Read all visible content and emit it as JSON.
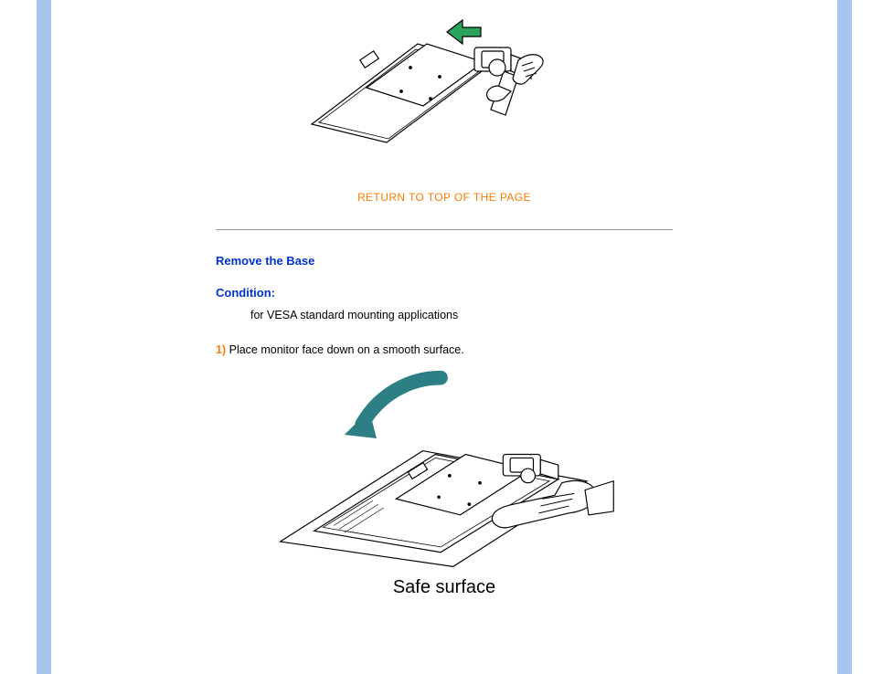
{
  "top_link": {
    "text": "RETURN TO TOP OF THE PAGE",
    "href": "#top"
  },
  "section": {
    "title": "Remove the Base",
    "condition_label": "Condition:",
    "condition_text": "for VESA standard mounting applications"
  },
  "step1": {
    "num": "1)",
    "text": "Place monitor face down on a smooth surface."
  },
  "bottom_caption": "Safe surface",
  "colors": {
    "accent": "#ff7a00",
    "link_blue": "#0033cc",
    "arrow_teal": "#2b7f85",
    "arrow_green": "#2aa35c"
  }
}
